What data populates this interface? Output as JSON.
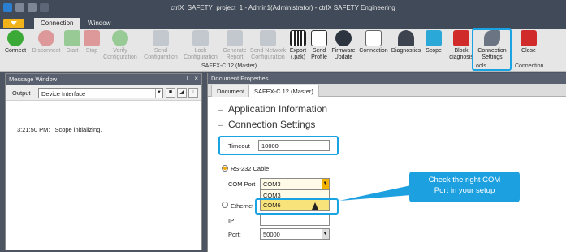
{
  "window": {
    "title": "ctrlX_SAFETY_project_1 - Admin1(Administrator) - ctrlX SAFETY Engineering"
  },
  "ribbon_tabs": [
    "Connection",
    "Window"
  ],
  "ribbon": {
    "buttons": [
      {
        "label": "Connect",
        "icon": "connect-icon",
        "enabled": true
      },
      {
        "label": "Disconnect",
        "icon": "disconnect-icon",
        "enabled": false
      },
      {
        "label": "Start",
        "icon": "start-icon",
        "enabled": false
      },
      {
        "label": "Stop",
        "icon": "stop-icon",
        "enabled": false
      },
      {
        "label": "Verify Configuration",
        "icon": "verify-icon",
        "enabled": false
      },
      {
        "label": "Send Configuration",
        "icon": "send-config-icon",
        "enabled": false
      },
      {
        "label": "Lock Configuration",
        "icon": "lock-icon",
        "enabled": false
      },
      {
        "label": "Generate Report",
        "icon": "report-icon",
        "enabled": false
      },
      {
        "label": "Send Network Configuration",
        "icon": "network-icon",
        "enabled": false
      },
      {
        "label": "Export (.pak)",
        "icon": "barcode-icon",
        "enabled": true
      },
      {
        "label": "Send Profile",
        "icon": "send-profile-icon",
        "enabled": true
      },
      {
        "label": "Firmware Update",
        "icon": "firmware-icon",
        "enabled": true
      },
      {
        "label": "Connection",
        "icon": "connection-doc-icon",
        "enabled": true
      },
      {
        "label": "Diagnostics",
        "icon": "diagnostics-icon",
        "enabled": true
      },
      {
        "label": "Scope",
        "icon": "scope-icon",
        "enabled": true
      },
      {
        "label": "Block diagnosis",
        "icon": "block-diagnosis-icon",
        "enabled": true
      },
      {
        "label": "Connection Settings",
        "icon": "wrench-icon",
        "enabled": true
      },
      {
        "label": "Close",
        "icon": "close-icon",
        "enabled": true
      }
    ],
    "group_label_main": "SAFEX-C.12 (Master)",
    "group_label_tools": "ools",
    "group_label_connection": "Connection"
  },
  "message_window": {
    "title": "Message Window",
    "output_label": "Output",
    "output_value": "Device Interface",
    "messages": [
      {
        "time": "3:21:50 PM:",
        "text": "Scope initializing."
      }
    ]
  },
  "document": {
    "title": "Document Properties",
    "tabs": [
      "Document",
      "SAFEX-C.12 (Master)"
    ],
    "sections": [
      "Application Information",
      "Connection Settings"
    ],
    "timeout_label": "Timeout",
    "timeout_value": "10000",
    "rs232_label": "RS-232 Cable",
    "com_port_label": "COM Port",
    "com_port_value": "COM3",
    "com_options": [
      "COM3",
      "COM6"
    ],
    "ethernet_label": "Ethernet",
    "ip_label": "IP",
    "port_label": "Port:",
    "port_value": "50000"
  },
  "callout": {
    "line1": "Check the right COM",
    "line2": "Port in your setup"
  },
  "colors": {
    "accent_highlight": "#1aa3e2",
    "callout_bg": "#1da0e0",
    "app_tab": "#f1b21a"
  }
}
